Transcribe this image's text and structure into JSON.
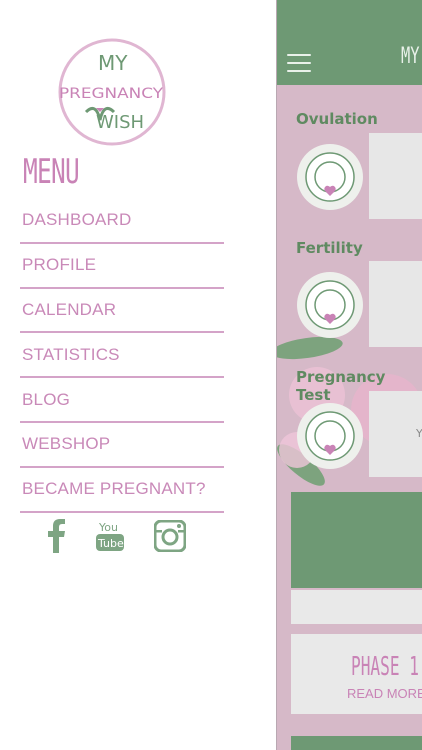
{
  "drawer": {
    "logo": {
      "line1": "MY",
      "line2": "PREGNANCY",
      "line3": "WISH"
    },
    "menu_title": "MENU",
    "items": [
      {
        "label": "DASHBOARD"
      },
      {
        "label": "PROFILE"
      },
      {
        "label": "CALENDAR"
      },
      {
        "label": "STATISTICS"
      },
      {
        "label": "BLOG"
      },
      {
        "label": "WEBSHOP"
      },
      {
        "label": "BECAME PREGNANT?"
      }
    ],
    "social": [
      "facebook-icon",
      "youtube-icon",
      "instagram-icon"
    ],
    "youtube_text": {
      "top": "You",
      "bottom": "Tube"
    }
  },
  "main": {
    "title": "MY",
    "sections": [
      {
        "label": "Ovulation"
      },
      {
        "label": "Fertility"
      },
      {
        "label": "Pregnancy Test"
      }
    ],
    "card_text": "Y",
    "phase": {
      "title": "PHASE 1",
      "more": "READ MORE"
    }
  },
  "colors": {
    "pink": "#c983b6",
    "green": "#6e9974",
    "menu_line": "#d4a3c8",
    "background_pink": "#d6b9c8"
  }
}
